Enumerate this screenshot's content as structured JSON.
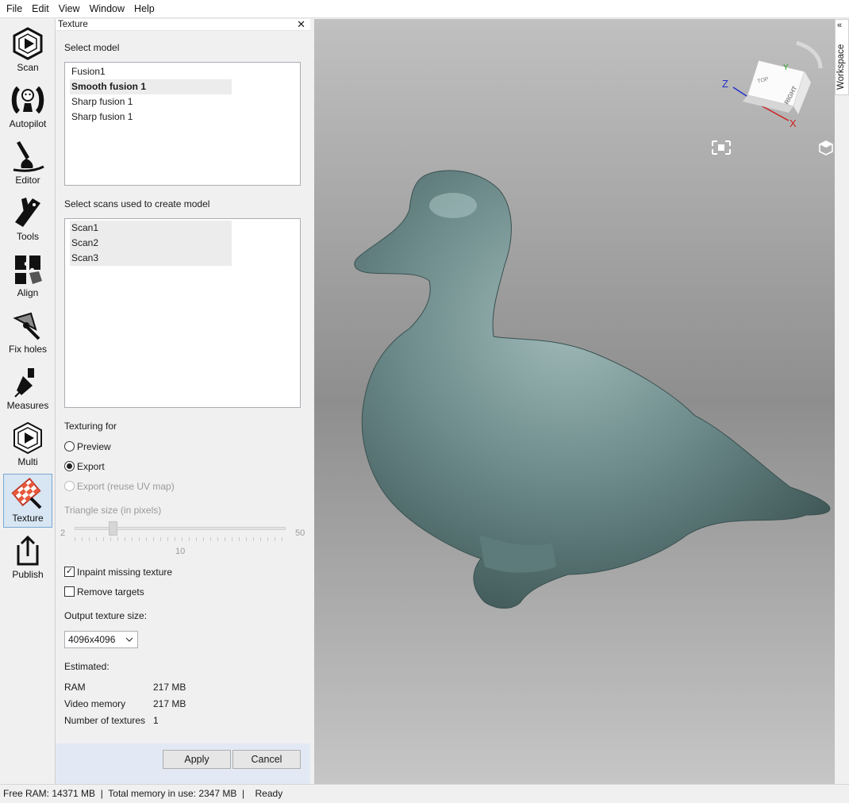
{
  "menu": [
    "File",
    "Edit",
    "View",
    "Window",
    "Help"
  ],
  "toolbar": {
    "items": [
      {
        "label": "Scan",
        "icon": "scan-icon"
      },
      {
        "label": "Autopilot",
        "icon": "autopilot-icon"
      },
      {
        "label": "Editor",
        "icon": "editor-icon"
      },
      {
        "label": "Tools",
        "icon": "tools-icon"
      },
      {
        "label": "Align",
        "icon": "align-icon"
      },
      {
        "label": "Fix holes",
        "icon": "fix-holes-icon"
      },
      {
        "label": "Measures",
        "icon": "measures-icon"
      },
      {
        "label": "Multi",
        "icon": "multi-icon"
      },
      {
        "label": "Texture",
        "icon": "texture-icon",
        "active": true
      },
      {
        "label": "Publish",
        "icon": "publish-icon"
      }
    ]
  },
  "panel": {
    "title": "Texture",
    "select_model_label": "Select model",
    "models": [
      {
        "name": "Fusion1",
        "selected": false
      },
      {
        "name": "Smooth fusion 1",
        "selected": true
      },
      {
        "name": "Sharp fusion 1",
        "selected": false
      },
      {
        "name": "Sharp fusion 1",
        "selected": false
      }
    ],
    "select_scans_label": "Select scans used to create model",
    "scans": [
      "Scan1",
      "Scan2",
      "Scan3"
    ],
    "texturing_for_label": "Texturing for",
    "options": {
      "preview": "Preview",
      "export": "Export",
      "export_reuse": "Export (reuse UV map)",
      "selected": "Export"
    },
    "triangle_size": {
      "label": "Triangle size (in pixels)",
      "min": "2",
      "max": "50",
      "value": "10",
      "fraction": 0.17
    },
    "inpaint_label": "Inpaint missing texture",
    "inpaint_checked": true,
    "remove_targets_label": "Remove targets",
    "remove_targets_checked": false,
    "output_size_label": "Output texture size:",
    "output_size_value": "4096x4096",
    "estimated": {
      "title": "Estimated:",
      "ram_label": "RAM",
      "ram_value": "217 MB",
      "video_label": "Video memory",
      "video_value": "217 MB",
      "textures_label": "Number of textures",
      "textures_value": "1"
    },
    "apply_label": "Apply",
    "cancel_label": "Cancel"
  },
  "viewport": {
    "axes": {
      "x": "X",
      "y": "Y",
      "z": "Z"
    },
    "cube_top": "TOP",
    "cube_right": "RIGHT",
    "workspace_label": "Workspace",
    "model_color": "#6e8c8c"
  },
  "status": {
    "free_ram": "Free RAM: 14371 MB",
    "total_memory": "Total memory in use: 2347 MB",
    "state": "Ready"
  }
}
